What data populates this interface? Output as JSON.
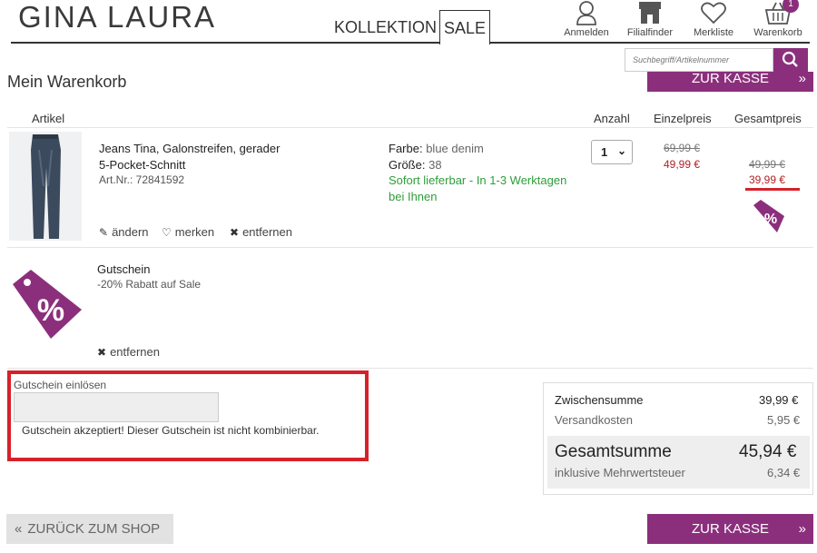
{
  "header": {
    "logo": "GINA LAURA",
    "tabs": [
      {
        "label": "KOLLEKTION"
      },
      {
        "label": "SALE"
      }
    ],
    "icons": [
      {
        "label": "Anmelden",
        "icon": "user-icon"
      },
      {
        "label": "Filialfinder",
        "icon": "store-icon"
      },
      {
        "label": "Merkliste",
        "icon": "heart-icon"
      },
      {
        "label": "Warenkorb",
        "icon": "basket-icon",
        "badge": "1"
      }
    ],
    "search_placeholder": "Suchbegriff/Artikelnummer"
  },
  "page_title": "Mein Warenkorb",
  "checkout_label": "ZUR KASSE",
  "checkout_arrow": "»",
  "columns": {
    "article": "Artikel",
    "qty": "Anzahl",
    "unit": "Einzelpreis",
    "total": "Gesamtpreis"
  },
  "product": {
    "name_line1": "Jeans Tina, Galonstreifen, gerader",
    "name_line2": "5-Pocket-Schnitt",
    "art_no": "Art.Nr.: 72841592",
    "color_label": "Farbe:",
    "color_value": "blue denim",
    "size_label": "Größe:",
    "size_value": "38",
    "availability_line1": "Sofort lieferbar - In 1-3 Werktagen",
    "availability_line2": "bei Ihnen",
    "qty": "1",
    "unit_old": "69,99 €",
    "unit_new": "49,99 €",
    "total_old": "49,99 €",
    "total_new": "39,99 €",
    "actions": {
      "edit": "ändern",
      "save": "merken",
      "remove": "entfernen"
    }
  },
  "voucher": {
    "title": "Gutschein",
    "desc": "-20% Rabatt auf Sale",
    "remove": "entfernen",
    "badge": "%"
  },
  "coupon": {
    "label": "Gutschein einlösen",
    "input_value": "",
    "message": "Gutschein akzeptiert! Dieser Gutschein ist nicht kombinierbar."
  },
  "summary": {
    "subtotal_label": "Zwischensumme",
    "subtotal": "39,99 €",
    "shipping_label": "Versandkosten",
    "shipping": "5,95 €",
    "total_label": "Gesamtsumme",
    "total": "45,94 €",
    "vat_label": "inklusive Mehrwertsteuer",
    "vat": "6,34 €"
  },
  "back_label": "ZURÜCK ZUM SHOP",
  "back_arrow": "«",
  "colors": {
    "brand": "#8b2f7c",
    "highlight": "#d6212a",
    "available": "#2e9e3a",
    "sale_price": "#b21f24"
  }
}
